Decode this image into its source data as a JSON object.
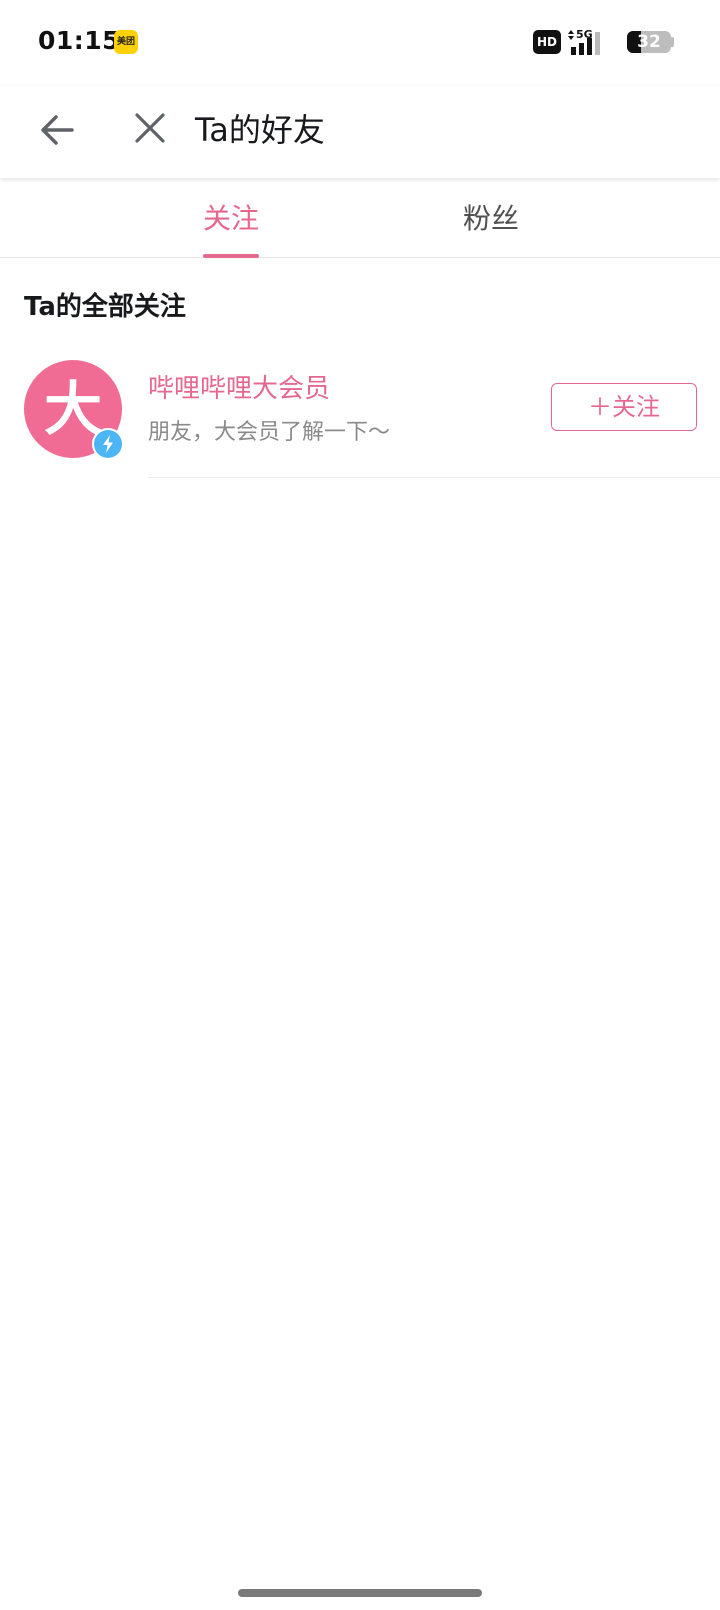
{
  "status_bar": {
    "time": "01:15",
    "app_badge": "美团",
    "hd": "HD",
    "network": "5G",
    "battery_level": "32",
    "battery_fraction": 0.32
  },
  "header": {
    "back_icon": "arrow-left-icon",
    "close_icon": "close-icon",
    "title": "Ta的好友"
  },
  "tabs": [
    {
      "label": "关注",
      "active": true
    },
    {
      "label": "粉丝",
      "active": false
    }
  ],
  "section": {
    "title": "Ta的全部关注"
  },
  "list": [
    {
      "avatar_char": "大",
      "name": "哔哩哔哩大会员",
      "description": "朋友，大会员了解一下～",
      "follow_label": "＋关注",
      "badge_icon": "lightning-icon"
    }
  ],
  "colors": {
    "accent": "#E5688F",
    "avatar_bg": "#F06C95",
    "badge_blue": "#4CB5F5",
    "text_primary": "#18191c",
    "text_secondary": "#8a8a8a"
  }
}
